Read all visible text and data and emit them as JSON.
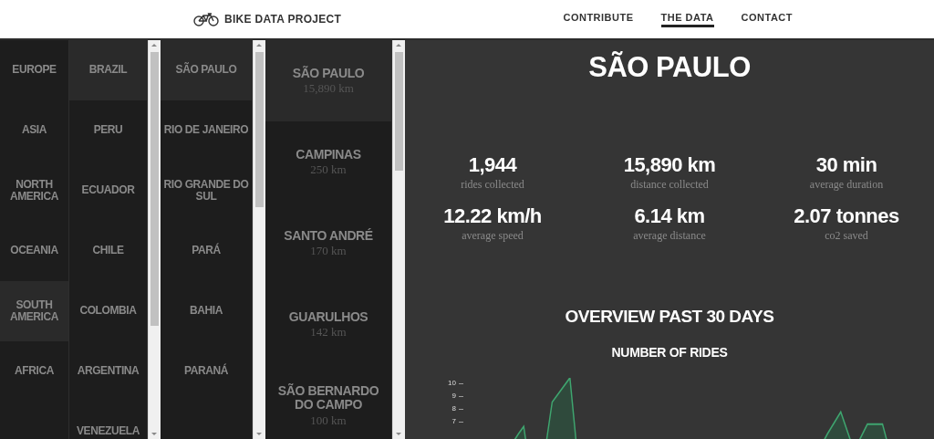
{
  "header": {
    "logo_text": "BIKE DATA PROJECT",
    "nav": [
      {
        "label": "CONTRIBUTE",
        "selected": false
      },
      {
        "label": "THE DATA",
        "selected": true
      },
      {
        "label": "CONTACT",
        "selected": false
      }
    ]
  },
  "continents": [
    {
      "label": "EUROPE",
      "selected": false
    },
    {
      "label": "ASIA",
      "selected": false
    },
    {
      "label": "NORTH AMERICA",
      "selected": false
    },
    {
      "label": "OCEANIA",
      "selected": false
    },
    {
      "label": "SOUTH AMERICA",
      "selected": true
    },
    {
      "label": "AFRICA",
      "selected": false
    }
  ],
  "countries": [
    {
      "label": "BRAZIL",
      "selected": true
    },
    {
      "label": "PERU",
      "selected": false
    },
    {
      "label": "ECUADOR",
      "selected": false
    },
    {
      "label": "CHILE",
      "selected": false
    },
    {
      "label": "COLOMBIA",
      "selected": false
    },
    {
      "label": "ARGENTINA",
      "selected": false
    },
    {
      "label": "VENEZUELA",
      "selected": false
    }
  ],
  "states": [
    {
      "label": "SÃO PAULO",
      "selected": true
    },
    {
      "label": "RIO DE JANEIRO",
      "selected": false
    },
    {
      "label": "RIO GRANDE DO SUL",
      "selected": false
    },
    {
      "label": "PARÁ",
      "selected": false
    },
    {
      "label": "BAHIA",
      "selected": false
    },
    {
      "label": "PARANÁ",
      "selected": false
    }
  ],
  "cities": [
    {
      "name": "SÃO PAULO",
      "distance": "15,890 km",
      "selected": true
    },
    {
      "name": "CAMPINAS",
      "distance": "250 km",
      "selected": false
    },
    {
      "name": "SANTO ANDRÉ",
      "distance": "170 km",
      "selected": false
    },
    {
      "name": "GUARULHOS",
      "distance": "142 km",
      "selected": false
    },
    {
      "name": "SÃO BERNARDO DO CAMPO",
      "distance": "100 km",
      "selected": false
    }
  ],
  "detail": {
    "title": "SÃO PAULO",
    "stats": [
      {
        "value": "1,944",
        "label": "rides collected"
      },
      {
        "value": "15,890 km",
        "label": "distance collected"
      },
      {
        "value": "30 min",
        "label": "average duration"
      },
      {
        "value": "12.22 km/h",
        "label": "average speed"
      },
      {
        "value": "6.14 km",
        "label": "average distance"
      },
      {
        "value": "2.07 tonnes",
        "label": "co2 saved"
      }
    ],
    "section_title": "OVERVIEW PAST 30 DAYS",
    "chart_title": "NUMBER OF RIDES",
    "y_ticks": [
      "10",
      "9",
      "8",
      "7"
    ]
  }
}
